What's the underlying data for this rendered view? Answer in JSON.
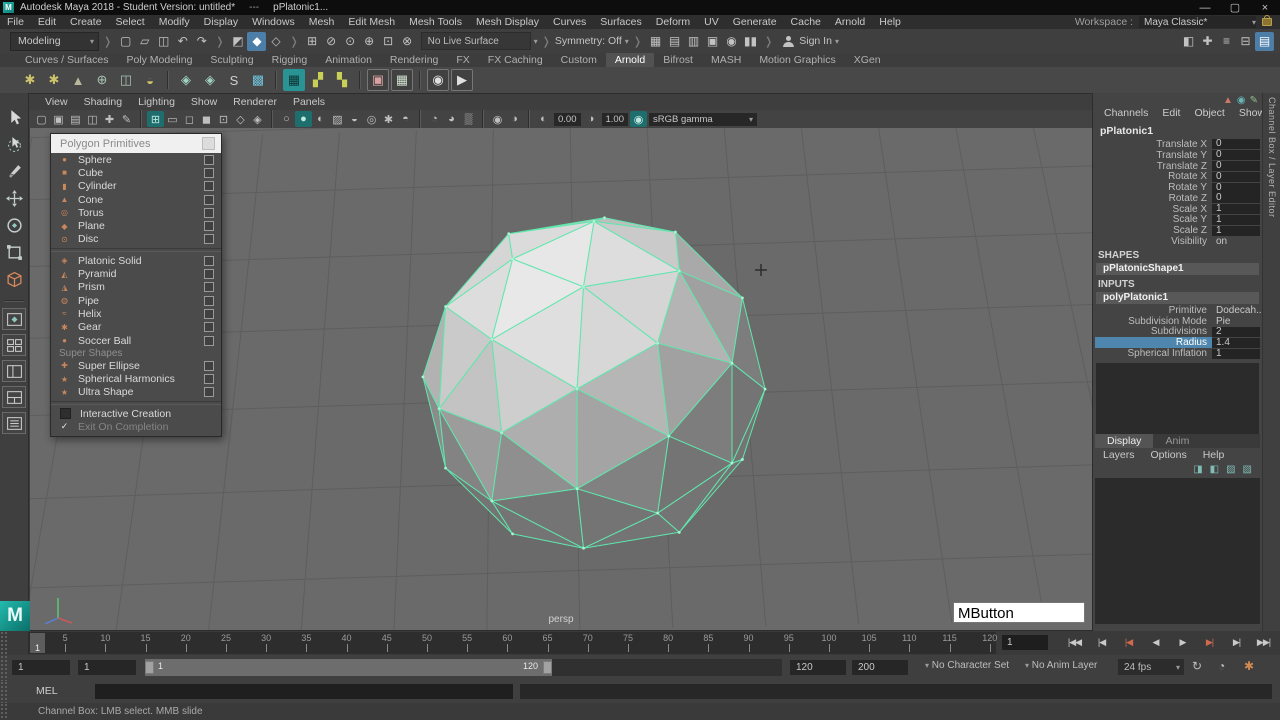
{
  "title_bar": {
    "app_title": "Autodesk Maya 2018 - Student Version: untitled*",
    "title_separator": "---",
    "active_object": "pPlatonic1...",
    "window_controls": [
      {
        "name": "minimize-button",
        "glyph": "—"
      },
      {
        "name": "maximize-button",
        "glyph": "▢"
      },
      {
        "name": "close-button",
        "glyph": "×"
      }
    ]
  },
  "menu_bar": {
    "items": [
      "File",
      "Edit",
      "Create",
      "Select",
      "Modify",
      "Display",
      "Windows",
      "Mesh",
      "Edit Mesh",
      "Mesh Tools",
      "Mesh Display",
      "Curves",
      "Surfaces",
      "Deform",
      "UV",
      "Generate",
      "Cache",
      "Arnold",
      "Help"
    ],
    "workspace_label": "Workspace :",
    "workspace_value": "Maya Classic*"
  },
  "status_line": {
    "menu_set": "Modeling",
    "file_icons": [
      {
        "name": "new-scene-icon",
        "glyph": "▢"
      },
      {
        "name": "open-scene-icon",
        "glyph": "▱"
      },
      {
        "name": "save-scene-icon",
        "glyph": "◫"
      },
      {
        "name": "undo-icon",
        "glyph": "↶"
      },
      {
        "name": "redo-icon",
        "glyph": "↷"
      }
    ],
    "selection_icons": [
      {
        "name": "select-hierarchy-icon",
        "glyph": "◩"
      },
      {
        "name": "select-object-icon",
        "glyph": "◆",
        "active": true
      },
      {
        "name": "select-component-icon",
        "glyph": "◇"
      }
    ],
    "snap_icons": [
      {
        "name": "snap-grid-icon",
        "glyph": "⊞"
      },
      {
        "name": "snap-curve-icon",
        "glyph": "⊘"
      },
      {
        "name": "snap-point-icon",
        "glyph": "⊙"
      },
      {
        "name": "snap-projected-center-icon",
        "glyph": "⊕"
      },
      {
        "name": "snap-view-plane-icon",
        "glyph": "⊡"
      },
      {
        "name": "make-live-icon",
        "glyph": "⊗"
      }
    ],
    "live_surface_label": "No Live Surface",
    "symmetry_label": "Symmetry: Off",
    "render_icons": [
      {
        "name": "open-render-view-icon",
        "glyph": "▦"
      },
      {
        "name": "render-current-frame-icon",
        "glyph": "▤"
      },
      {
        "name": "ipr-render-icon",
        "glyph": "▥"
      },
      {
        "name": "render-settings-icon",
        "glyph": "▣"
      },
      {
        "name": "launch-hypershade-icon",
        "glyph": "◉"
      },
      {
        "name": "pause-viewport-icon",
        "glyph": "▮▮"
      }
    ],
    "sign_in_label": "Sign In",
    "sidebar_toggle_icons": [
      {
        "name": "modeling-toolkit-icon",
        "glyph": "◧"
      },
      {
        "name": "hik-character-icon",
        "glyph": "✚"
      },
      {
        "name": "attribute-editor-icon",
        "glyph": "≡"
      },
      {
        "name": "tool-settings-icon",
        "glyph": "⊟"
      },
      {
        "name": "channel-box-icon",
        "glyph": "▤",
        "active": true
      }
    ]
  },
  "shelf": {
    "rail_icons": [
      {
        "name": "shelf-tabs-menu-icon",
        "glyph": "▾"
      },
      {
        "name": "shelf-menu-icon",
        "glyph": "✱"
      }
    ],
    "tabs": [
      "Curves / Surfaces",
      "Poly Modeling",
      "Sculpting",
      "Rigging",
      "Animation",
      "Rendering",
      "FX",
      "FX Caching",
      "Custom",
      "Arnold",
      "Bifrost",
      "MASH",
      "Motion Graphics",
      "XGen"
    ],
    "active_tab": "Arnold",
    "icons": [
      {
        "name": "area-light-icon",
        "glyph": "✱",
        "color": "#cdc36a"
      },
      {
        "name": "skydome-light-icon",
        "glyph": "✱",
        "color": "#cdc36a"
      },
      {
        "name": "photometric-light-icon",
        "glyph": "▲",
        "color": "#b9b9a0"
      },
      {
        "name": "mesh-light-icon",
        "glyph": "⊕",
        "color": "#a9c2b2"
      },
      {
        "name": "light-portal-icon",
        "glyph": "◫",
        "color": "#a9c2b2"
      },
      {
        "name": "physical-sky-icon",
        "glyph": "◒",
        "color": "#cdc36a"
      },
      {
        "name": "standin-icon",
        "glyph": "◈",
        "color": "#9fd0c0",
        "sep": true
      },
      {
        "name": "standin-export-icon",
        "glyph": "◈",
        "color": "#9fd0c0"
      },
      {
        "name": "curve-collector-icon",
        "glyph": "S",
        "color": "#d0d0d0"
      },
      {
        "name": "volume-icon",
        "glyph": "▩",
        "color": "#6fc0d8"
      },
      {
        "name": "tx-manager-icon",
        "glyph": "▦",
        "active": true,
        "sep": true
      },
      {
        "name": "tx-update-icon",
        "glyph": "▞",
        "color": "#c8d058"
      },
      {
        "name": "tx-delete-icon",
        "glyph": "▚",
        "color": "#c8d058"
      },
      {
        "name": "render-region-icon",
        "glyph": "▣",
        "boxed": true,
        "color": "#d8a0a0",
        "sep": true
      },
      {
        "name": "render-selected-icon",
        "glyph": "▦",
        "boxed": true,
        "color": "#cfe0cf"
      },
      {
        "name": "arnold-renderview-icon",
        "glyph": "◉",
        "boxed": true,
        "color": "#e0e0e0",
        "sep": true
      },
      {
        "name": "render-sequence-icon",
        "glyph": "▶",
        "boxed": true,
        "color": "#e0e0e0"
      }
    ]
  },
  "toolbox": {
    "tools": [
      {
        "name": "select-tool-icon",
        "symbol": "cursor"
      },
      {
        "name": "lasso-tool-icon",
        "symbol": "lasso"
      },
      {
        "name": "paint-select-tool-icon",
        "symbol": "brush"
      },
      {
        "name": "move-tool-icon",
        "symbol": "move"
      },
      {
        "name": "rotate-tool-icon",
        "symbol": "rotate"
      },
      {
        "name": "scale-tool-icon",
        "symbol": "scale"
      },
      {
        "name": "last-tool-platonic-icon",
        "symbol": "cube"
      }
    ],
    "layouts": [
      {
        "name": "single-pane-layout-icon",
        "symbol": "pane1"
      },
      {
        "name": "four-pane-layout-icon",
        "symbol": "pane4"
      },
      {
        "name": "persp-outliner-layout-icon",
        "symbol": "pane2v"
      },
      {
        "name": "split-pane-layout-icon",
        "symbol": "pane2h"
      },
      {
        "name": "outliner-panel-icon",
        "symbol": "list"
      }
    ]
  },
  "viewport": {
    "menus": [
      "View",
      "Shading",
      "Lighting",
      "Show",
      "Renderer",
      "Panels"
    ],
    "toolbar_icons": [
      {
        "name": "lock-camera-icon",
        "glyph": "▢"
      },
      {
        "name": "camera-attributes-icon",
        "glyph": "▣"
      },
      {
        "name": "bookmarks-icon",
        "glyph": "▤"
      },
      {
        "name": "image-plane-icon",
        "glyph": "◫"
      },
      {
        "name": "2d-pan-zoom-icon",
        "glyph": "✚"
      },
      {
        "name": "grease-pencil-icon",
        "glyph": "✎"
      },
      {
        "name": "grid-icon",
        "glyph": "⊞",
        "sep": true,
        "active": true
      },
      {
        "name": "film-gate-icon",
        "glyph": "▭"
      },
      {
        "name": "resolution-gate-icon",
        "glyph": "◻"
      },
      {
        "name": "gate-mask-icon",
        "glyph": "◼"
      },
      {
        "name": "field-chart-icon",
        "glyph": "⊡"
      },
      {
        "name": "safe-action-icon",
        "glyph": "◇"
      },
      {
        "name": "safe-title-icon",
        "glyph": "◈"
      },
      {
        "name": "wireframe-icon",
        "glyph": "○",
        "sep": true
      },
      {
        "name": "smooth-shade-icon",
        "glyph": "●",
        "active": true
      },
      {
        "name": "bounding-box-icon",
        "glyph": "◐"
      },
      {
        "name": "textured-icon",
        "glyph": "▨"
      },
      {
        "name": "use-default-material-icon",
        "glyph": "◒"
      },
      {
        "name": "wireframe-on-shaded-icon",
        "glyph": "◎"
      },
      {
        "name": "lights-icon",
        "glyph": "✱"
      },
      {
        "name": "shadows-icon",
        "glyph": "◓"
      },
      {
        "name": "screen-space-ao-icon",
        "glyph": "◔",
        "sep": true
      },
      {
        "name": "motion-blur-icon",
        "glyph": "◕"
      },
      {
        "name": "multisample-icon",
        "glyph": "▒"
      },
      {
        "name": "isolate-select-icon",
        "glyph": "◉",
        "sep": true
      },
      {
        "name": "xray-icon",
        "glyph": "◑"
      },
      {
        "name": "exposure-icon",
        "glyph": "◐",
        "sep": true
      },
      {
        "name": "gamma-icon",
        "glyph": "◑",
        "field_after": "gamma"
      },
      {
        "name": "color-management-icon",
        "glyph": "◉",
        "active": true
      }
    ],
    "fields": {
      "exposure": "0.00",
      "gamma": "1.00",
      "view_transform": "sRGB gamma"
    },
    "camera_label": "persp",
    "key_overlay": "MButton"
  },
  "popup_menu": {
    "title": "Polygon Primitives",
    "items": [
      {
        "t": "item",
        "label": "Sphere",
        "glyph": "●"
      },
      {
        "t": "item",
        "label": "Cube",
        "glyph": "■"
      },
      {
        "t": "item",
        "label": "Cylinder",
        "glyph": "▮"
      },
      {
        "t": "item",
        "label": "Cone",
        "glyph": "▲"
      },
      {
        "t": "item",
        "label": "Torus",
        "glyph": "◎"
      },
      {
        "t": "item",
        "label": "Plane",
        "glyph": "◆"
      },
      {
        "t": "item",
        "label": "Disc",
        "glyph": "⊙"
      },
      {
        "t": "sep"
      },
      {
        "t": "item",
        "label": "Platonic Solid",
        "glyph": "◈"
      },
      {
        "t": "item",
        "label": "Pyramid",
        "glyph": "◭"
      },
      {
        "t": "item",
        "label": "Prism",
        "glyph": "◮"
      },
      {
        "t": "item",
        "label": "Pipe",
        "glyph": "◍"
      },
      {
        "t": "item",
        "label": "Helix",
        "glyph": "≈"
      },
      {
        "t": "item",
        "label": "Gear",
        "glyph": "✱"
      },
      {
        "t": "item",
        "label": "Soccer Ball",
        "glyph": "●"
      },
      {
        "t": "header",
        "label": "Super Shapes"
      },
      {
        "t": "item",
        "label": "Super Ellipse",
        "glyph": "✚"
      },
      {
        "t": "item",
        "label": "Spherical Harmonics",
        "glyph": "★"
      },
      {
        "t": "item",
        "label": "Ultra Shape",
        "glyph": "★"
      },
      {
        "t": "sep"
      },
      {
        "t": "toggle",
        "label": "Interactive Creation",
        "checked": false
      },
      {
        "t": "toggle",
        "label": "Exit On Completion",
        "checked": true,
        "disabled": true
      }
    ]
  },
  "channel_box": {
    "panel_icons": [
      {
        "name": "channel-manipulator-icon",
        "glyph": "▲",
        "color": "#cc7766"
      },
      {
        "name": "speed-ramp-icon",
        "glyph": "◉",
        "color": "#66b8b8"
      },
      {
        "name": "hyperbolic-slider-icon",
        "glyph": "✎",
        "color": "#8fbf8f"
      }
    ],
    "menus": [
      "Channels",
      "Edit",
      "Object",
      "Show"
    ],
    "node_name": "pPlatonic1",
    "attributes": [
      {
        "label": "Translate X",
        "value": "0",
        "field": true
      },
      {
        "label": "Translate Y",
        "value": "0",
        "field": true
      },
      {
        "label": "Translate Z",
        "value": "0",
        "field": true
      },
      {
        "label": "Rotate X",
        "value": "0",
        "field": true
      },
      {
        "label": "Rotate Y",
        "value": "0",
        "field": true
      },
      {
        "label": "Rotate Z",
        "value": "0",
        "field": true
      },
      {
        "label": "Scale X",
        "value": "1",
        "field": true
      },
      {
        "label": "Scale Y",
        "value": "1",
        "field": true
      },
      {
        "label": "Scale Z",
        "value": "1",
        "field": true
      },
      {
        "label": "Visibility",
        "value": "on",
        "field": false
      }
    ],
    "shapes_header": "SHAPES",
    "shape_node": "pPlatonicShape1",
    "inputs_header": "INPUTS",
    "input_node": "polyPlatonic1",
    "input_attributes": [
      {
        "label": "Primitive",
        "value": "Dodecah...",
        "field": false
      },
      {
        "label": "Subdivision Mode",
        "value": "Pie",
        "field": false
      },
      {
        "label": "Subdivisions",
        "value": "2",
        "field": true
      },
      {
        "label": "Radius",
        "value": "1.4",
        "field": true,
        "selected": true
      },
      {
        "label": "Spherical Inflation",
        "value": "1",
        "field": true
      }
    ],
    "side_tab_label": "Channel Box / Layer Editor"
  },
  "layer_editor": {
    "tabs": [
      {
        "label": "Display",
        "active": true
      },
      {
        "label": "Anim",
        "active": false
      }
    ],
    "menus": [
      "Layers",
      "Options",
      "Help"
    ],
    "icons": [
      {
        "name": "layer-up-icon",
        "glyph": "◨"
      },
      {
        "name": "layer-down-icon",
        "glyph": "◧"
      },
      {
        "name": "new-empty-layer-icon",
        "glyph": "▨"
      },
      {
        "name": "new-layer-from-selected-icon",
        "glyph": "▧"
      }
    ]
  },
  "time_slider": {
    "ticks": [
      "5",
      "10",
      "15",
      "20",
      "25",
      "30",
      "35",
      "40",
      "45",
      "50",
      "55",
      "60",
      "65",
      "70",
      "75",
      "80",
      "85",
      "90",
      "95",
      "100",
      "105",
      "110",
      "115",
      "120"
    ],
    "current_frame": "1",
    "current_time_field": "1",
    "playback_buttons": [
      {
        "name": "go-to-start-button",
        "glyph": "|◀◀"
      },
      {
        "name": "step-back-frame-button",
        "glyph": "|◀"
      },
      {
        "name": "step-back-key-button",
        "glyph": "|◀",
        "red": true
      },
      {
        "name": "play-backwards-button",
        "glyph": "◀"
      },
      {
        "name": "play-forwards-button",
        "glyph": "▶"
      },
      {
        "name": "step-forward-key-button",
        "glyph": "▶|",
        "red": true
      },
      {
        "name": "step-forward-frame-button",
        "glyph": "▶|"
      },
      {
        "name": "go-to-end-button",
        "glyph": "▶▶|"
      }
    ]
  },
  "range_slider": {
    "animation_start": "1",
    "playback_start": "1",
    "range_start_label": "1",
    "range_end_label": "120",
    "playback_end": "120",
    "animation_end": "200",
    "character_set": "No Character Set",
    "anim_layer": "No Anim Layer",
    "fps": "24 fps",
    "icons": [
      {
        "name": "playback-loop-icon",
        "glyph": "↻"
      },
      {
        "name": "anim-preferences-icon",
        "glyph": "◔"
      },
      {
        "name": "auto-keyframe-icon",
        "glyph": "✱",
        "color": "#d08a50"
      }
    ]
  },
  "command_line": {
    "label": "MEL"
  },
  "help_line": {
    "text": "Channel Box: LMB select. MMB slide"
  },
  "colors": {
    "viewport_bg": "#6a6a6a",
    "wireframe_green": "#5fe7ad",
    "selection_blue": "#4e86ad",
    "icon_orange": "#c9875c",
    "shelf_active_teal": "#2a9393"
  }
}
